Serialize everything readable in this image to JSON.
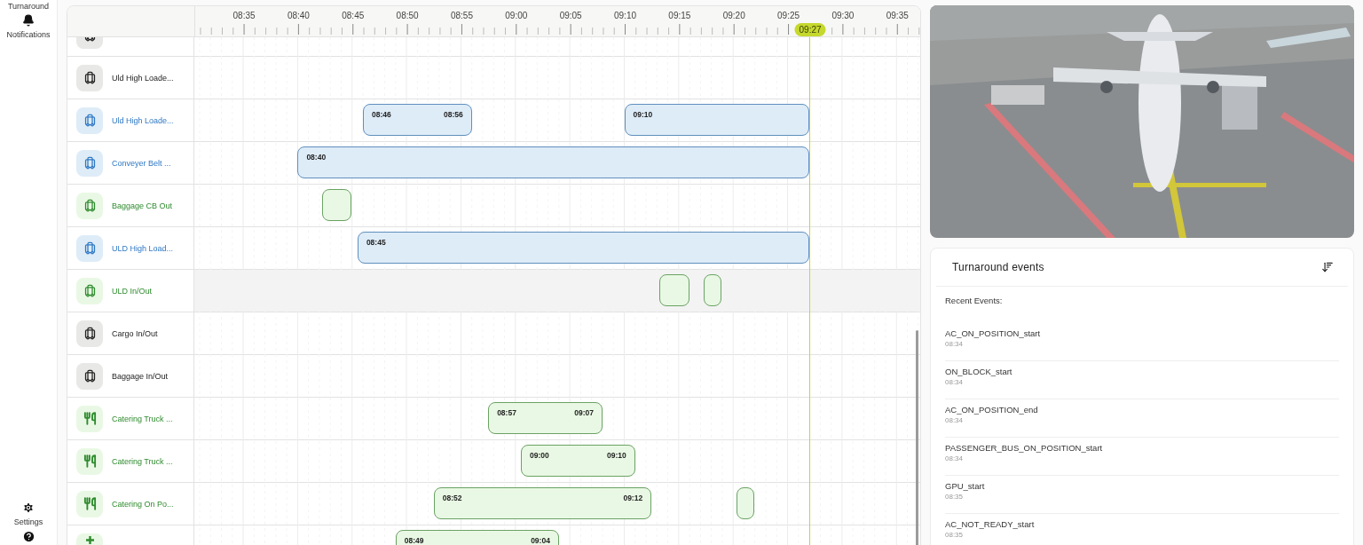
{
  "sidebar": {
    "items": [
      {
        "label": "Turnaround",
        "kind": "cut"
      },
      {
        "label": "Notifications",
        "kind": "bell"
      }
    ],
    "bottom": [
      {
        "label": "Settings",
        "kind": "gear"
      },
      {
        "kind": "help"
      }
    ]
  },
  "timeline": {
    "ticks": [
      "08:35",
      "08:40",
      "08:45",
      "08:50",
      "08:55",
      "09:00",
      "09:05",
      "09:10",
      "09:15",
      "09:20",
      "09:25",
      "09:30",
      "09:35"
    ],
    "now": "09:27",
    "rows": [
      {
        "kind": "baggage",
        "color": "#222222",
        "hovered": false,
        "bars": []
      },
      {
        "kind": "baggage",
        "label": "Uld High Loade...",
        "color": "#222222",
        "hovered": false,
        "bars": []
      },
      {
        "kind": "baggage",
        "label": "Uld High Loade...",
        "color": "#2f78c4",
        "hovered": false,
        "bars": [
          {
            "kind": "done",
            "start": "08:46",
            "end": "08:56"
          },
          {
            "kind": "running",
            "start": "09:10"
          }
        ]
      },
      {
        "kind": "baggage",
        "label": "Conveyer Belt ...",
        "color": "#2f78c4",
        "hovered": false,
        "bars": [
          {
            "kind": "running",
            "start": "08:40"
          }
        ]
      },
      {
        "kind": "baggage",
        "label": "Baggage CB Out",
        "color": "#2e8b2e",
        "hovered": false,
        "bars": [
          {
            "kind": "done"
          }
        ]
      },
      {
        "kind": "baggage",
        "label": "ULD High Load...",
        "color": "#2f78c4",
        "hovered": false,
        "bars": [
          {
            "kind": "running",
            "start": "08:45"
          }
        ]
      },
      {
        "kind": "baggage",
        "label": "ULD In/Out",
        "color": "#2e8b2e",
        "hovered": true,
        "bars": [
          {
            "kind": "done"
          },
          {
            "kind": "done"
          }
        ]
      },
      {
        "kind": "baggage",
        "label": "Cargo In/Out",
        "color": "#222222",
        "hovered": false,
        "bars": []
      },
      {
        "kind": "baggage",
        "label": "Baggage In/Out",
        "color": "#222222",
        "hovered": false,
        "bars": []
      },
      {
        "kind": "catering",
        "label": "Catering Truck ...",
        "color": "#2e8b2e",
        "hovered": false,
        "bars": [
          {
            "kind": "done",
            "start": "08:57",
            "end": "09:07"
          }
        ]
      },
      {
        "kind": "catering",
        "label": "Catering Truck ...",
        "color": "#2e8b2e",
        "hovered": false,
        "bars": [
          {
            "kind": "done",
            "start": "09:00",
            "end": "09:10"
          }
        ]
      },
      {
        "kind": "catering",
        "label": "Catering On Po...",
        "color": "#2e8b2e",
        "hovered": false,
        "bars": [
          {
            "kind": "done",
            "start": "08:52",
            "end": "09:12"
          },
          {
            "kind": "done"
          }
        ]
      },
      {
        "kind": "other",
        "color": "#2e8b2e",
        "hovered": false,
        "bars": [
          {
            "kind": "done",
            "start": "08:49",
            "end": "09:04"
          }
        ]
      }
    ]
  },
  "events": {
    "title": "Turnaround events",
    "subtitle": "Recent Events:",
    "items": [
      {
        "name": "AC_ON_POSITION_start",
        "time": "08:34"
      },
      {
        "name": "ON_BLOCK_start",
        "time": "08:34"
      },
      {
        "name": "AC_ON_POSITION_end",
        "time": "08:34"
      },
      {
        "name": "PASSENGER_BUS_ON_POSITION_start",
        "time": "08:34"
      },
      {
        "name": "GPU_start",
        "time": "08:35"
      },
      {
        "name": "AC_NOT_READY_start",
        "time": "08:35"
      }
    ]
  }
}
